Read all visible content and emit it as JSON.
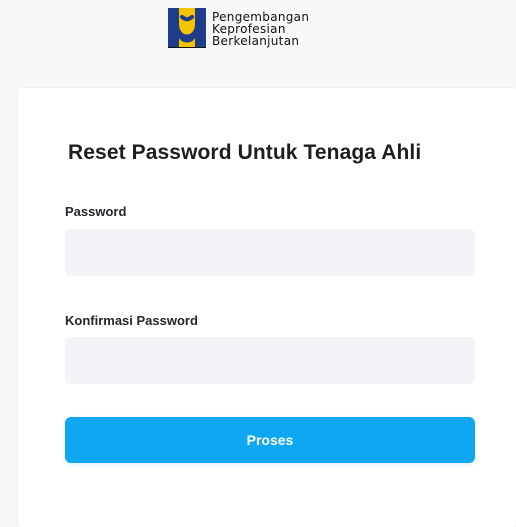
{
  "brand": {
    "line1": "Pengembangan",
    "line2": "Keprofesian",
    "line3": "Berkelanjutan",
    "logo_icon": "pu-logo-icon",
    "colors": {
      "yellow": "#F5C400",
      "blue": "#1F3C8A",
      "black": "#111111"
    }
  },
  "form": {
    "title": "Reset Password Untuk Tenaga Ahli",
    "password_label": "Password",
    "password_value": "",
    "password_placeholder": "",
    "confirm_label": "Konfirmasi Password",
    "confirm_value": "",
    "confirm_placeholder": "",
    "submit_label": "Proses"
  },
  "colors": {
    "accent": "#10A7F2",
    "input_bg": "#F1F3F6",
    "page_bg": "#F7F8FA",
    "card_bg": "#FFFFFF"
  }
}
